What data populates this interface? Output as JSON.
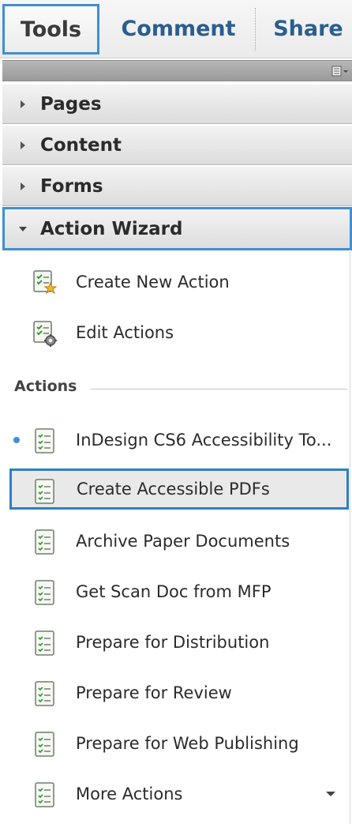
{
  "tabs": [
    {
      "label": "Tools"
    },
    {
      "label": "Comment"
    },
    {
      "label": "Share"
    }
  ],
  "panels": [
    {
      "label": "Pages",
      "expanded": false
    },
    {
      "label": "Content",
      "expanded": false
    },
    {
      "label": "Forms",
      "expanded": false
    },
    {
      "label": "Action Wizard",
      "expanded": true
    }
  ],
  "wizard_items": [
    {
      "label": "Create New Action",
      "icon": "create-action-icon"
    },
    {
      "label": "Edit Actions",
      "icon": "edit-actions-icon"
    }
  ],
  "actions_section": {
    "label": "Actions",
    "items": [
      {
        "label": "InDesign CS6 Accessibility To...",
        "icon": "action-checklist-icon"
      },
      {
        "label": "Create Accessible PDFs",
        "icon": "action-checklist-icon"
      },
      {
        "label": "Archive Paper Documents",
        "icon": "action-checklist-icon"
      },
      {
        "label": "Get Scan Doc from MFP",
        "icon": "action-checklist-icon"
      },
      {
        "label": "Prepare for Distribution",
        "icon": "action-checklist-icon"
      },
      {
        "label": "Prepare for Review",
        "icon": "action-checklist-icon"
      },
      {
        "label": "Prepare for Web Publishing",
        "icon": "action-checklist-icon"
      },
      {
        "label": "More Actions",
        "icon": "action-checklist-icon"
      }
    ]
  },
  "colors": {
    "accent": "#3f8fd2",
    "tab_text": "#2a5e8f",
    "panel_bg": "#dcdcdc"
  }
}
